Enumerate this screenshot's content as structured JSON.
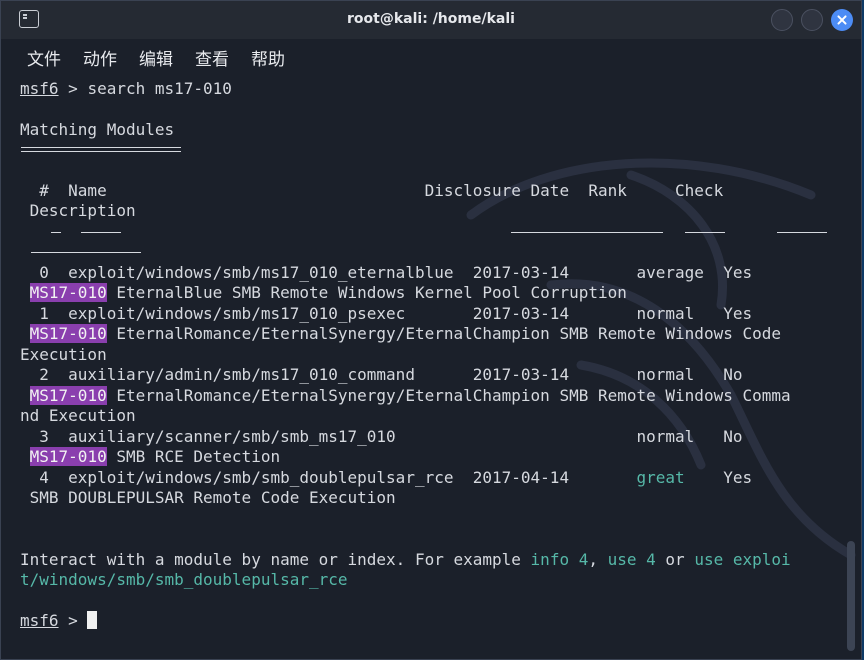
{
  "window": {
    "title": "root@kali: /home/kali",
    "icon": "terminal-icon",
    "controls": [
      "minimize-icon",
      "maximize-icon",
      "close-icon"
    ]
  },
  "menu": [
    "文件",
    "动作",
    "编辑",
    "查看",
    "帮助"
  ],
  "prompt": {
    "name": "msf6",
    "sep": " > "
  },
  "command": "search ms17-010",
  "heading": "Matching Modules",
  "table": {
    "header1": "  #  Name                                 Disclosure Date  Rank     Check",
    "header2": " Description",
    "rows": [
      {
        "line1": "  0  exploit/windows/smb/ms17_010_eternalblue  2017-03-14       average  Yes",
        "desc_hl": "MS17-010",
        "desc_rest": " EternalBlue SMB Remote Windows Kernel Pool Corruption",
        "desc_cont": ""
      },
      {
        "line1": "  1  exploit/windows/smb/ms17_010_psexec       2017-03-14       normal   Yes",
        "desc_hl": "MS17-010",
        "desc_rest": " EternalRomance/EternalSynergy/EternalChampion SMB Remote Windows Code",
        "desc_cont": "Execution"
      },
      {
        "line1": "  2  auxiliary/admin/smb/ms17_010_command      2017-03-14       normal   No",
        "desc_hl": "MS17-010",
        "desc_rest": " EternalRomance/EternalSynergy/EternalChampion SMB Remote Windows Comma",
        "desc_cont": "nd Execution"
      },
      {
        "line1": "  3  auxiliary/scanner/smb/smb_ms17_010                         normal   No",
        "desc_hl": "MS17-010",
        "desc_rest": " SMB RCE Detection",
        "desc_cont": ""
      },
      {
        "line1a": "  4  exploit/windows/smb/smb_doublepulsar_rce  2017-04-14       ",
        "rank": "great",
        "line1b": "    Yes",
        "desc": " SMB DOUBLEPULSAR Remote Code Execution"
      }
    ]
  },
  "footer": {
    "p1": "Interact with a module by name or index. For example ",
    "c1": "info 4",
    "p2": ", ",
    "c2": "use 4",
    "p3": " or ",
    "c3": "use exploi",
    "c4": "t/windows/smb/smb_doublepulsar_rce"
  },
  "colors": {
    "background": "#1b202a",
    "text": "#d6d9df",
    "highlight": "#8a3fae",
    "accent": "#56b8a8",
    "close_button": "#4c8cf5"
  }
}
